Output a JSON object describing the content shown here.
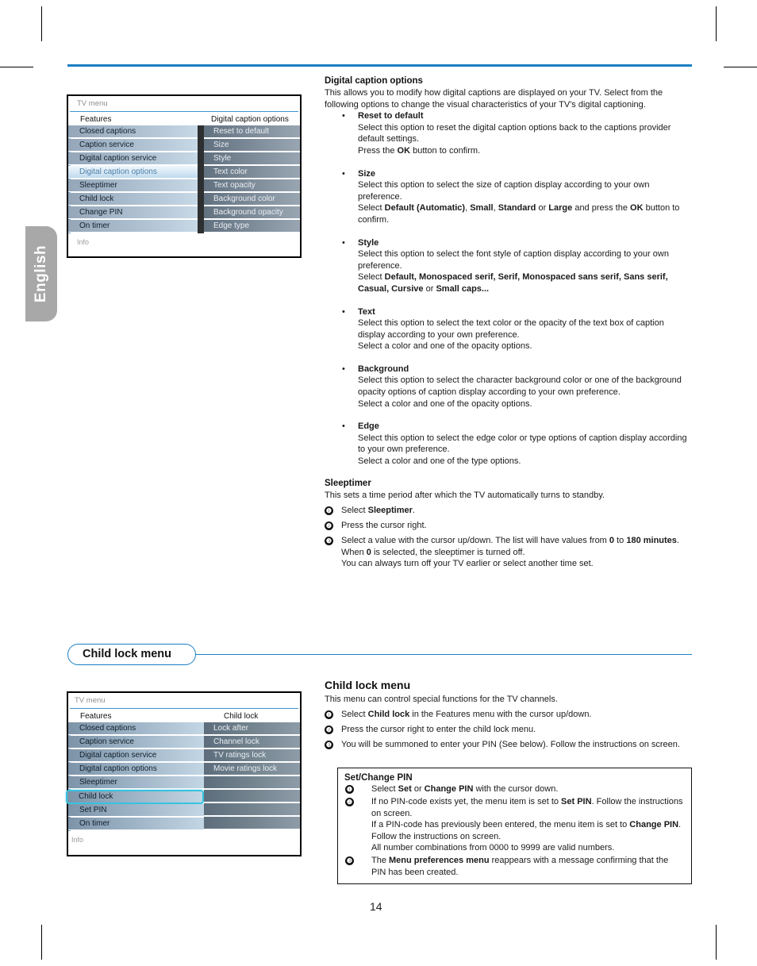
{
  "page": {
    "number": "14",
    "language_tab": "English",
    "accent_blue": "#1b7fc4"
  },
  "section_pill": {
    "label": "Child lock menu"
  },
  "tv_menu_top": {
    "window_title": "TV menu",
    "left_header": "Features",
    "right_header": "Digital caption options",
    "left_items": [
      {
        "label": "Closed captions",
        "selected": false
      },
      {
        "label": "Caption service",
        "selected": false
      },
      {
        "label": "Digital caption service",
        "selected": false
      },
      {
        "label": "Digital caption options",
        "selected": true
      },
      {
        "label": "Sleeptimer",
        "selected": false
      },
      {
        "label": "Child lock",
        "selected": false
      },
      {
        "label": "Change PIN",
        "selected": false
      },
      {
        "label": "On timer",
        "selected": false
      }
    ],
    "right_items": [
      {
        "label": "Reset to default"
      },
      {
        "label": "Size"
      },
      {
        "label": "Style"
      },
      {
        "label": "Text color"
      },
      {
        "label": "Text opacity"
      },
      {
        "label": "Background color"
      },
      {
        "label": "Background opacity"
      },
      {
        "label": "Edge type"
      }
    ],
    "footer": "Info"
  },
  "tv_menu_bottom": {
    "window_title": "TV menu",
    "left_header": "Features",
    "right_header": "Child lock",
    "left_items": [
      {
        "label": "Closed captions",
        "selected": false
      },
      {
        "label": "Caption service",
        "selected": false
      },
      {
        "label": "Digital caption service",
        "selected": false
      },
      {
        "label": "Digital caption options",
        "selected": false
      },
      {
        "label": "Sleeptimer",
        "selected": false
      },
      {
        "label": "Child lock",
        "selected": true
      },
      {
        "label": "Set PIN",
        "selected": false
      },
      {
        "label": "On timer",
        "selected": false
      }
    ],
    "right_items": [
      {
        "label": "Lock after"
      },
      {
        "label": "Channel lock"
      },
      {
        "label": "TV ratings lock"
      },
      {
        "label": "Movie ratings lock"
      },
      {
        "label": ""
      },
      {
        "label": ""
      },
      {
        "label": ""
      },
      {
        "label": ""
      }
    ],
    "footer": "Info"
  },
  "digital_caption_options": {
    "heading": "Digital caption options",
    "intro": "This allows you to modify how digital captions are displayed on your TV. Select from the following options to change the visual characteristics of your TV's digital captioning.",
    "bullets": [
      {
        "title": "Reset to default",
        "lines": [
          "Select this option to reset the digital caption options back to the captions provider default settings.",
          "Press the OK button to confirm."
        ]
      },
      {
        "title": "Size",
        "lines": [
          "Select this option to select the size of caption display according to your own preference.",
          "Select Default (Automatic), Small, Standard or Large and press the OK button to confirm."
        ]
      },
      {
        "title": "Style",
        "lines": [
          "Select this option to select the font style of caption display according to your own preference.",
          "Select Default, Monospaced serif, Serif, Monospaced sans serif, Sans serif, Casual, Cursive or Small caps..."
        ]
      },
      {
        "title": "Text",
        "lines": [
          "Select this option to select the text color or the opacity of the text box of caption display according to your own preference.",
          "Select a color and one of the opacity options."
        ]
      },
      {
        "title": "Background",
        "lines": [
          "Select this option to select the character background color or one of the background opacity options of caption display according to your own preference.",
          "Select a color and one of the opacity options."
        ]
      },
      {
        "title": "Edge",
        "lines": [
          "Select this option to select the edge color or type options of caption display according to your own preference.",
          "Select a color and one of the type options."
        ]
      }
    ]
  },
  "sleeptimer": {
    "heading": "Sleeptimer",
    "intro": "This sets a time period after which the TV automatically turns to standby.",
    "steps": [
      {
        "n": "1",
        "text": "Select Sleeptimer."
      },
      {
        "n": "2",
        "text": "Press the cursor right."
      },
      {
        "n": "3",
        "text": "Select a value with the cursor up/down. The list will have values from 0 to 180 minutes. When 0 is selected, the sleeptimer is turned off. You can always turn off your TV earlier or select another time set."
      }
    ]
  },
  "child_lock": {
    "heading": "Child lock menu",
    "intro": "This menu can control special functions for the TV channels.",
    "steps": [
      {
        "n": "1",
        "text": "Select Child lock in the Features menu with the cursor up/down."
      },
      {
        "n": "2",
        "text": "Press the cursor right to enter the child lock menu."
      },
      {
        "n": "3",
        "text": "You will be summoned to enter your PIN (See below). Follow the instructions on screen."
      }
    ]
  },
  "pin_box": {
    "title": "Set/Change PIN",
    "steps": [
      {
        "n": "1",
        "text": "Select Set or Change PIN with the cursor down."
      },
      {
        "n": "2",
        "text": "If no PIN-code exists yet, the menu item is set to Set PIN. Follow the instructions on screen. If a PIN-code has previously been entered, the menu item is set to Change PIN. Follow the instructions on screen. All number combinations from 0000 to 9999 are valid numbers."
      },
      {
        "n": "3",
        "text": "The Menu preferences menu reappears with a message confirming that the PIN has been created."
      }
    ]
  }
}
